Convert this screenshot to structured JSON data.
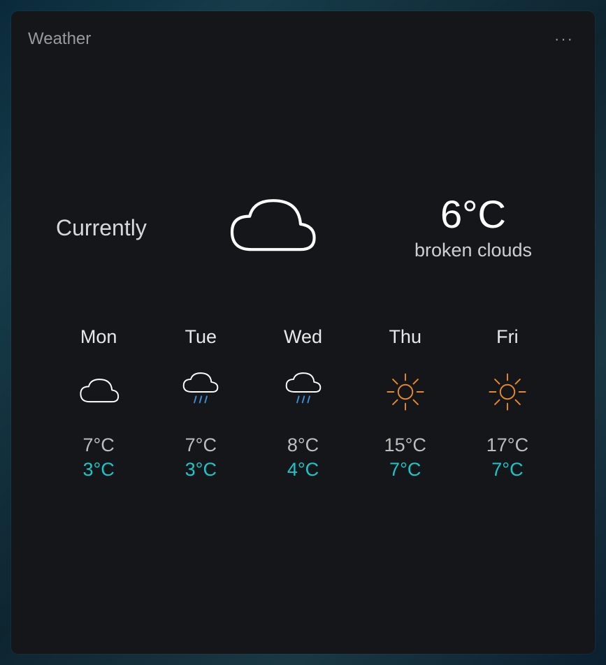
{
  "card": {
    "title": "Weather"
  },
  "current": {
    "label": "Currently",
    "temp": "6°C",
    "description": "broken clouds",
    "icon": "cloud"
  },
  "forecast": [
    {
      "day": "Mon",
      "icon": "cloud",
      "hi": "7°C",
      "lo": "3°C"
    },
    {
      "day": "Tue",
      "icon": "rain",
      "hi": "7°C",
      "lo": "3°C"
    },
    {
      "day": "Wed",
      "icon": "rain",
      "hi": "8°C",
      "lo": "4°C"
    },
    {
      "day": "Thu",
      "icon": "sun",
      "hi": "15°C",
      "lo": "7°C"
    },
    {
      "day": "Fri",
      "icon": "sun",
      "hi": "17°C",
      "lo": "7°C"
    }
  ],
  "colors": {
    "accent_low": "#1cc6c6",
    "sun": "#e88a2a",
    "rain": "#3a8fd6"
  }
}
